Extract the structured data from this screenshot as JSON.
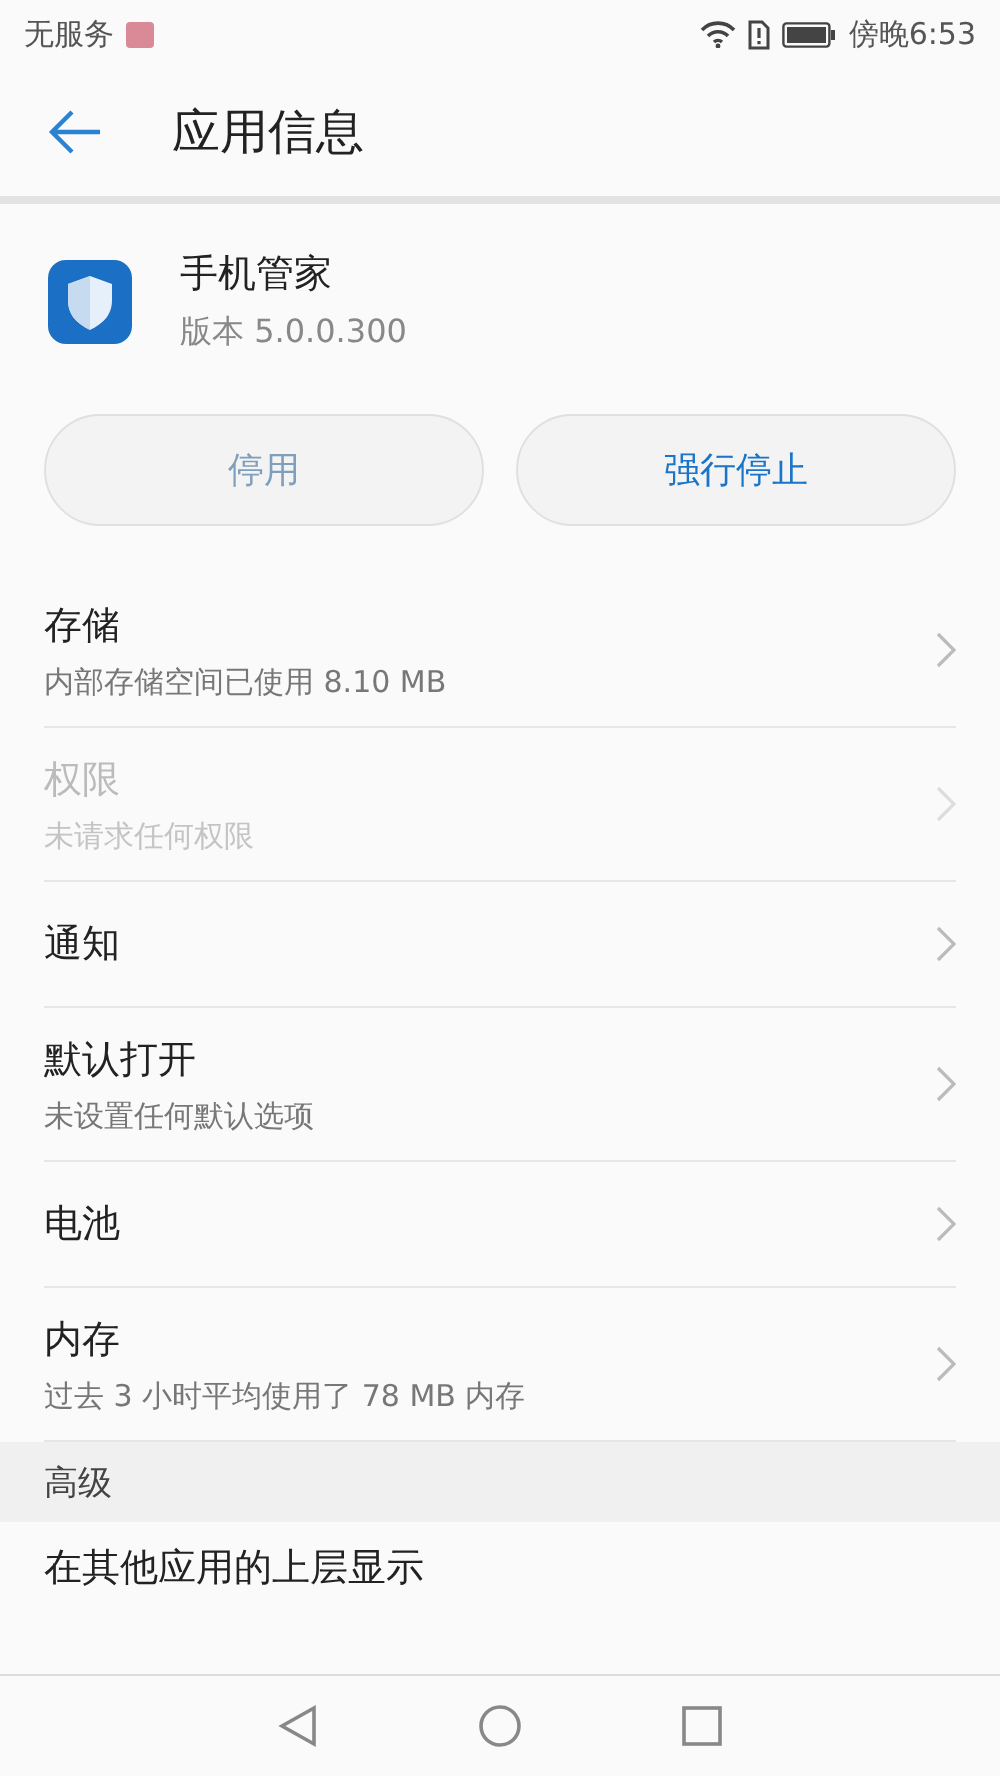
{
  "status_bar": {
    "carrier": "无服务",
    "time": "傍晚6:53"
  },
  "header": {
    "title": "应用信息"
  },
  "app": {
    "name": "手机管家",
    "version": "版本 5.0.0.300"
  },
  "buttons": [
    {
      "label": "停用",
      "disabled": true
    },
    {
      "label": "强行停止",
      "disabled": false
    }
  ],
  "items": [
    {
      "title": "存储",
      "subtitle": "内部存储空间已使用 8.10 MB",
      "disabled": false
    },
    {
      "title": "权限",
      "subtitle": "未请求任何权限",
      "disabled": true
    },
    {
      "title": "通知",
      "disabled": false
    },
    {
      "title": "默认打开",
      "subtitle": "未设置任何默认选项",
      "disabled": false
    },
    {
      "title": "电池",
      "disabled": false
    },
    {
      "title": "内存",
      "subtitle": "过去 3 小时平均使用了 78 MB 内存",
      "disabled": false
    }
  ],
  "section": {
    "title": "高级",
    "items": [
      {
        "title": "在其他应用的上层显示"
      }
    ]
  }
}
